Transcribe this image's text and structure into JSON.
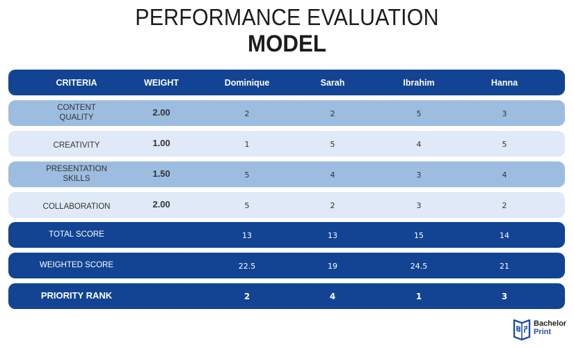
{
  "title": {
    "line1": "PERFORMANCE EVALUATION",
    "line2": "MODEL"
  },
  "table": {
    "headers": [
      "CRITERIA",
      "WEIGHT",
      "Dominique",
      "Sarah",
      "Ibrahim",
      "Hanna"
    ],
    "criteria_rows": [
      {
        "criteria_line1": "CONTENT",
        "criteria_line2": "QUALITY",
        "weight": "2.00",
        "scores": [
          "2",
          "2",
          "5",
          "3"
        ]
      },
      {
        "criteria_line1": "CREATIVITY",
        "criteria_line2": "",
        "weight": "1.00",
        "scores": [
          "1",
          "5",
          "4",
          "5"
        ]
      },
      {
        "criteria_line1": "PRESENTATION",
        "criteria_line2": "SKILLS",
        "weight": "1.50",
        "scores": [
          "5",
          "4",
          "3",
          "4"
        ]
      },
      {
        "criteria_line1": "COLLABORATION",
        "criteria_line2": "",
        "weight": "2.00",
        "scores": [
          "5",
          "2",
          "3",
          "2"
        ]
      }
    ],
    "summary_rows": [
      {
        "label": "TOTAL SCORE",
        "values": [
          "13",
          "13",
          "15",
          "14"
        ]
      },
      {
        "label": "WEIGHTED SCORE",
        "values": [
          "22.5",
          "19",
          "24.5",
          "21"
        ]
      },
      {
        "label": "PRIORITY RANK",
        "values": [
          "2",
          "4",
          "1",
          "3"
        ]
      }
    ]
  },
  "colors": {
    "header_blue": "#124493",
    "mid_blue": "#9dbde0",
    "light_blue": "#dfe9f7"
  },
  "logo": {
    "icon": "book-logo-icon",
    "line1": "Bachelor",
    "line2": "Print"
  }
}
